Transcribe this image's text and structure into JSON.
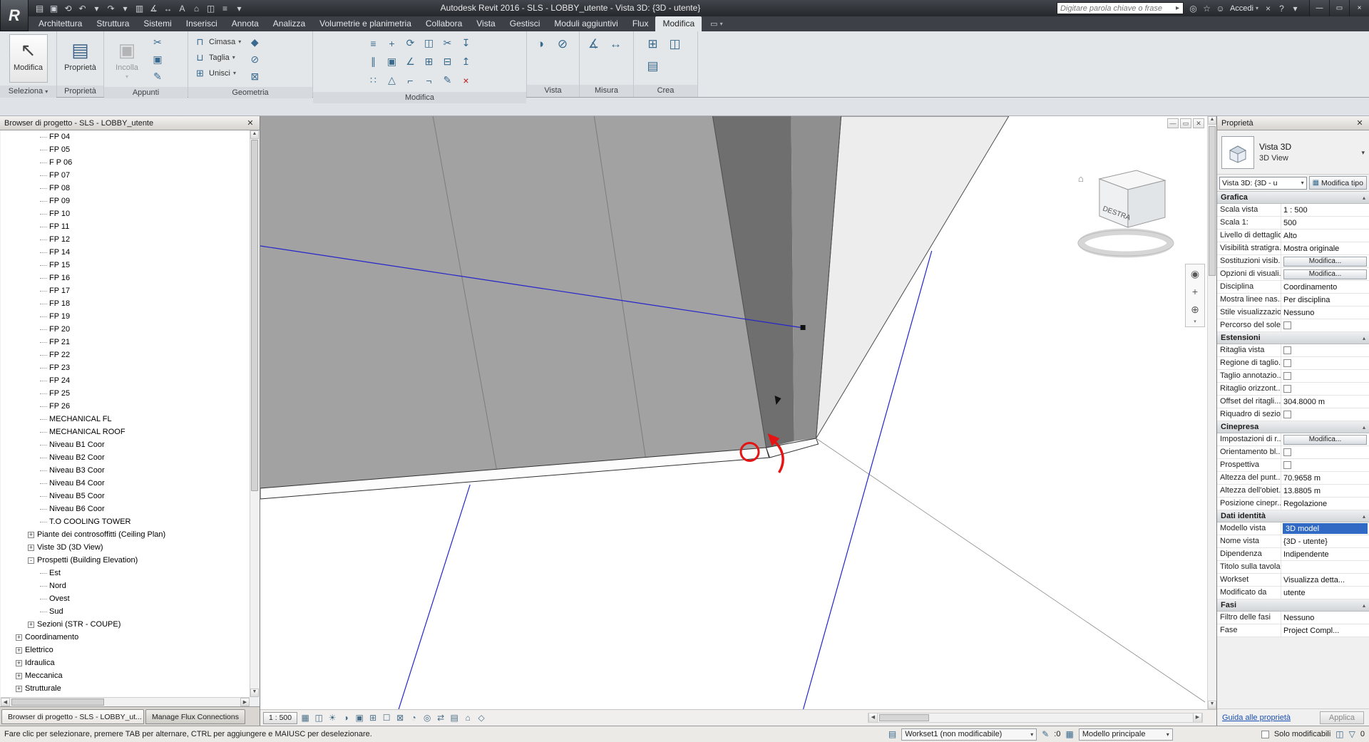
{
  "colors": {
    "selection_blue": "#316ac5",
    "guide_blue": "#2424cc",
    "annotation_red": "#e51414",
    "link_blue": "#1a4fb3"
  },
  "ui": {
    "caret_down": "▾",
    "arrow_up": "▲",
    "arrow_down": "▼",
    "arrow_left": "◀",
    "arrow_right": "▶"
  },
  "titlebar": {
    "title": "Autodesk Revit 2016 -   SLS - LOBBY_utente - Vista 3D: {3D - utente}",
    "logo_letter": "R",
    "search_placeholder": "Digitare parola chiave o frase",
    "search_go_glyph": "▸",
    "signin_label": "Accedi",
    "qat": [
      {
        "name": "open-icon",
        "glyph": "▤"
      },
      {
        "name": "save-icon",
        "glyph": "▣"
      },
      {
        "name": "sync-with-central-icon",
        "glyph": "⟲"
      },
      {
        "name": "undo-icon",
        "glyph": "↶"
      },
      {
        "name": "undo-dropdown-icon",
        "glyph": "▾"
      },
      {
        "name": "redo-icon",
        "glyph": "↷"
      },
      {
        "name": "redo-dropdown-icon",
        "glyph": "▾"
      },
      {
        "name": "print-icon",
        "glyph": "▥"
      },
      {
        "name": "measure-icon",
        "glyph": "∡"
      },
      {
        "name": "aligned-dimension-icon",
        "glyph": "↔"
      },
      {
        "name": "text-icon",
        "glyph": "A"
      },
      {
        "name": "default-3d-view-icon",
        "glyph": "⌂"
      },
      {
        "name": "section-icon",
        "glyph": "◫"
      },
      {
        "name": "thin-lines-icon",
        "glyph": "≡"
      },
      {
        "name": "qat-customize-icon",
        "glyph": "▾"
      }
    ],
    "pre_icons": [
      {
        "name": "communication-center-icon",
        "glyph": "◎"
      },
      {
        "name": "favorites-icon",
        "glyph": "☆"
      },
      {
        "name": "user-icon",
        "glyph": "☺"
      }
    ],
    "post_icons": [
      {
        "name": "exchange-apps-icon",
        "glyph": "×"
      },
      {
        "name": "help-icon",
        "glyph": "?"
      },
      {
        "name": "help-dropdown-icon",
        "glyph": "▾"
      }
    ],
    "window_buttons": [
      {
        "name": "minimize-button",
        "glyph": "—"
      },
      {
        "name": "restore-button",
        "glyph": "▭"
      },
      {
        "name": "close-button",
        "glyph": "×"
      }
    ]
  },
  "ribbon": {
    "tabs": [
      "Architettura",
      "Struttura",
      "Sistemi",
      "Inserisci",
      "Annota",
      "Analizza",
      "Volumetrie e planimetria",
      "Collabora",
      "Vista",
      "Gestisci",
      "Moduli aggiuntivi",
      "Flux",
      "Modifica"
    ],
    "active_tab": "Modifica",
    "panel_labels": [
      "Seleziona",
      "Proprietà",
      "Appunti",
      "Geometria",
      "Modifica",
      "Vista",
      "Misura",
      "Crea"
    ],
    "select_tool_label": "Modifica",
    "select_tool_glyph": "↖",
    "properties_glyph": "▤",
    "paste_label": "Incolla",
    "paste_glyph": "▣",
    "clipboard_small": [
      {
        "name": "cut-to-clipboard-icon",
        "glyph": "✂"
      },
      {
        "name": "copy-to-clipboard-icon",
        "glyph": "▣"
      },
      {
        "name": "match-type-properties-icon",
        "glyph": "✎"
      }
    ],
    "geometry_items": [
      {
        "label": "Cimasa",
        "name": "cope-icon",
        "glyph": "⊓"
      },
      {
        "label": "Taglia",
        "name": "cut-geometry-icon",
        "glyph": "⊔"
      },
      {
        "label": "Unisci",
        "name": "join-geometry-icon",
        "glyph": "⊞"
      }
    ],
    "geometry_extra": [
      {
        "name": "paint-icon",
        "glyph": "◆"
      },
      {
        "name": "remove-paint-icon",
        "glyph": "⊘"
      },
      {
        "name": "demolish-icon",
        "glyph": "⊠"
      }
    ],
    "modify_tools": [
      {
        "name": "align-icon",
        "glyph": "≡"
      },
      {
        "name": "move-icon",
        "glyph": "+"
      },
      {
        "name": "rotate-icon",
        "glyph": "⟳"
      },
      {
        "name": "mirror-axis-icon",
        "glyph": "◫"
      },
      {
        "name": "split-icon",
        "glyph": "✂"
      },
      {
        "name": "pin-icon",
        "glyph": "↧"
      },
      {
        "name": "offset-icon",
        "glyph": "∥"
      },
      {
        "name": "copy-icon",
        "glyph": "▣"
      },
      {
        "name": "trim-corner-icon",
        "glyph": "∠"
      },
      {
        "name": "mirror-draw-icon",
        "glyph": "⊞"
      },
      {
        "name": "split-gap-icon",
        "glyph": "⊟"
      },
      {
        "name": "unpin-icon",
        "glyph": "↥"
      },
      {
        "name": "array-icon",
        "glyph": "∷"
      },
      {
        "name": "scale-icon",
        "glyph": "△"
      },
      {
        "name": "trim-single-icon",
        "glyph": "⌐"
      },
      {
        "name": "trim-multi-icon",
        "glyph": "¬"
      },
      {
        "name": "match-properties-icon",
        "glyph": "✎"
      },
      {
        "name": "delete-icon",
        "glyph": "×",
        "color": "#b51414"
      }
    ],
    "view_tools": [
      {
        "name": "override-graphics-icon",
        "glyph": "◑"
      },
      {
        "name": "hide-in-view-icon",
        "glyph": "⊘"
      }
    ],
    "measure_tools": [
      {
        "name": "measure-tool-icon",
        "glyph": "∡"
      },
      {
        "name": "dimension-tool-icon",
        "glyph": "↔"
      }
    ],
    "create_tools": [
      {
        "name": "create-group-icon",
        "glyph": "⊞"
      },
      {
        "name": "create-similar-icon",
        "glyph": "◫"
      },
      {
        "name": "create-parts-icon",
        "glyph": "▤"
      }
    ]
  },
  "browser": {
    "header": "Browser di progetto - SLS - LOBBY_utente",
    "close_glyph": "✕",
    "tabs": [
      "Browser di progetto - SLS - LOBBY_ut...",
      "Manage Flux Connections"
    ],
    "tree": [
      {
        "label": "FP 04",
        "level": 3
      },
      {
        "label": "FP 05",
        "level": 3
      },
      {
        "label": "F P 06",
        "level": 3
      },
      {
        "label": "FP 07",
        "level": 3
      },
      {
        "label": "FP 08",
        "level": 3
      },
      {
        "label": "FP 09",
        "level": 3
      },
      {
        "label": "FP 10",
        "level": 3
      },
      {
        "label": "FP 11",
        "level": 3
      },
      {
        "label": "FP 12",
        "level": 3
      },
      {
        "label": "FP 14",
        "level": 3
      },
      {
        "label": "FP 15",
        "level": 3
      },
      {
        "label": "FP 16",
        "level": 3
      },
      {
        "label": "FP 17",
        "level": 3
      },
      {
        "label": "FP 18",
        "level": 3
      },
      {
        "label": "FP 19",
        "level": 3
      },
      {
        "label": "FP 20",
        "level": 3
      },
      {
        "label": "FP 21",
        "level": 3
      },
      {
        "label": "FP 22",
        "level": 3
      },
      {
        "label": "FP 23",
        "level": 3
      },
      {
        "label": "FP 24",
        "level": 3
      },
      {
        "label": "FP 25",
        "level": 3
      },
      {
        "label": "FP 26",
        "level": 3
      },
      {
        "label": "MECHANICAL FL",
        "level": 3
      },
      {
        "label": "MECHANICAL ROOF",
        "level": 3
      },
      {
        "label": "Niveau B1 Coor",
        "level": 3
      },
      {
        "label": "Niveau B2 Coor",
        "level": 3
      },
      {
        "label": "Niveau B3 Coor",
        "level": 3
      },
      {
        "label": "Niveau B4 Coor",
        "level": 3
      },
      {
        "label": "Niveau B5 Coor",
        "level": 3
      },
      {
        "label": "Niveau B6 Coor",
        "level": 3
      },
      {
        "label": "T.O COOLING TOWER",
        "level": 3
      },
      {
        "label": "Piante dei controsoffitti (Ceiling Plan)",
        "level": 2,
        "expand": "plus"
      },
      {
        "label": "Viste 3D (3D View)",
        "level": 2,
        "expand": "plus"
      },
      {
        "label": "Prospetti (Building Elevation)",
        "level": 2,
        "expand": "minus"
      },
      {
        "label": "Est",
        "level": 3
      },
      {
        "label": "Nord",
        "level": 3
      },
      {
        "label": "Ovest",
        "level": 3
      },
      {
        "label": "Sud",
        "level": 3
      },
      {
        "label": "Sezioni (STR - COUPE)",
        "level": 2,
        "expand": "plus"
      },
      {
        "label": "Coordinamento",
        "level": 1,
        "expand": "plus"
      },
      {
        "label": "Elettrico",
        "level": 1,
        "expand": "plus"
      },
      {
        "label": "Idraulica",
        "level": 1,
        "expand": "plus"
      },
      {
        "label": "Meccanica",
        "level": 1,
        "expand": "plus"
      },
      {
        "label": "Strutturale",
        "level": 1,
        "expand": "plus"
      }
    ]
  },
  "viewport": {
    "viewcube_label": "DESTRA",
    "scale_label": "1 : 500",
    "window_buttons": {
      "minimize": "—",
      "restore": "▭",
      "close": "✕"
    },
    "nav": {
      "wheel": "◉",
      "pan": "+",
      "zoom": "⊕"
    },
    "view_controls": [
      {
        "name": "detail-level-icon",
        "glyph": "▦"
      },
      {
        "name": "visual-style-icon",
        "glyph": "◫"
      },
      {
        "name": "sun-path-icon",
        "glyph": "☀"
      },
      {
        "name": "shadows-icon",
        "glyph": "◑"
      },
      {
        "name": "rendering-dialog-icon",
        "glyph": "▣"
      },
      {
        "name": "crop-view-icon",
        "glyph": "⊞"
      },
      {
        "name": "crop-region-icon",
        "glyph": "☐"
      },
      {
        "name": "lock-3d-view-icon",
        "glyph": "⊠"
      },
      {
        "name": "temporary-hide-isolate-icon",
        "glyph": "◔"
      },
      {
        "name": "reveal-hidden-icon",
        "glyph": "◎"
      },
      {
        "name": "worksharing-display-icon",
        "glyph": "⇄"
      },
      {
        "name": "temporary-view-properties-icon",
        "glyph": "▤"
      },
      {
        "name": "analytical-model-icon",
        "glyph": "⌂"
      },
      {
        "name": "displacement-sets-icon",
        "glyph": "◇"
      }
    ]
  },
  "properties": {
    "header": "Proprietà",
    "close_glyph": "✕",
    "type_name": "Vista 3D",
    "type_family": "3D View",
    "type_selector_value": "Vista 3D: {3D - u",
    "edit_type_label": "Modifica tipo",
    "edit_type_glyph": "▦",
    "help_link": "Guida alle proprietà",
    "apply_label": "Applica",
    "sections": [
      {
        "title": "Grafica",
        "rows": [
          {
            "label": "Scala vista",
            "value": "1 : 500",
            "kind": "text"
          },
          {
            "label": "Scala 1:",
            "value": "500",
            "kind": "text"
          },
          {
            "label": "Livello di dettaglio",
            "value": "Alto",
            "kind": "text"
          },
          {
            "label": "Visibilità stratigra...",
            "value": "Mostra originale",
            "kind": "text"
          },
          {
            "label": "Sostituzioni visib...",
            "value": "Modifica...",
            "kind": "button"
          },
          {
            "label": "Opzioni di visuali...",
            "value": "Modifica...",
            "kind": "button"
          },
          {
            "label": "Disciplina",
            "value": "Coordinamento",
            "kind": "text"
          },
          {
            "label": "Mostra linee nas...",
            "value": "Per disciplina",
            "kind": "text"
          },
          {
            "label": "Stile visualizzazio...",
            "value": "Nessuno",
            "kind": "text"
          },
          {
            "label": "Percorso del sole",
            "value": "",
            "kind": "check"
          }
        ]
      },
      {
        "title": "Estensioni",
        "rows": [
          {
            "label": "Ritaglia vista",
            "value": "",
            "kind": "check"
          },
          {
            "label": "Regione di taglio...",
            "value": "",
            "kind": "check"
          },
          {
            "label": "Taglio annotazio...",
            "value": "",
            "kind": "check"
          },
          {
            "label": "Ritaglio orizzont...",
            "value": "",
            "kind": "check"
          },
          {
            "label": "Offset del ritagli...",
            "value": "304.8000 m",
            "kind": "text"
          },
          {
            "label": "Riquadro di sezio...",
            "value": "",
            "kind": "check"
          }
        ]
      },
      {
        "title": "Cinepresa",
        "rows": [
          {
            "label": "Impostazioni di r...",
            "value": "Modifica...",
            "kind": "button"
          },
          {
            "label": "Orientamento bl...",
            "value": "",
            "kind": "check"
          },
          {
            "label": "Prospettiva",
            "value": "",
            "kind": "check"
          },
          {
            "label": "Altezza del punt...",
            "value": "70.9658 m",
            "kind": "text"
          },
          {
            "label": "Altezza dell'obiet...",
            "value": "13.8805 m",
            "kind": "text"
          },
          {
            "label": "Posizione cinepr...",
            "value": "Regolazione",
            "kind": "text"
          }
        ]
      },
      {
        "title": "Dati identità",
        "rows": [
          {
            "label": "Modello vista",
            "value": "3D model",
            "kind": "selected"
          },
          {
            "label": "Nome vista",
            "value": "{3D - utente}",
            "kind": "text"
          },
          {
            "label": "Dipendenza",
            "value": "Indipendente",
            "kind": "text"
          },
          {
            "label": "Titolo sulla tavola",
            "value": "",
            "kind": "empty"
          },
          {
            "label": "Workset",
            "value": "Visualizza detta...",
            "kind": "text"
          },
          {
            "label": "Modificato da",
            "value": "utente",
            "kind": "text"
          }
        ]
      },
      {
        "title": "Fasi",
        "rows": [
          {
            "label": "Filtro delle fasi",
            "value": "Nessuno",
            "kind": "text"
          },
          {
            "label": "Fase",
            "value": "Project Compl...",
            "kind": "text"
          }
        ]
      }
    ]
  },
  "statusbar": {
    "hint": "Fare clic per selezionare, premere TAB per alternare, CTRL per aggiungere e MAIUSC per deselezionare.",
    "workset_label": "Workset1 (non modificabile)",
    "requests_count": ":0",
    "design_option_label": "Modello principale",
    "editable_only_label": "Solo modificabili",
    "selection_count": "0",
    "icons": {
      "workset": "▤",
      "pencil": "✎",
      "design": "▦",
      "grid": "◫",
      "filter": "▽"
    }
  }
}
